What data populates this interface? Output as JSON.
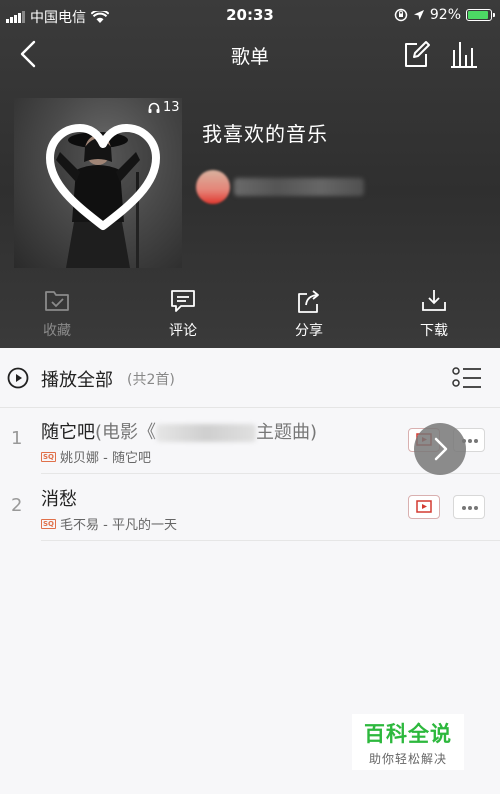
{
  "status_bar": {
    "carrier": "中国电信",
    "time": "20:33",
    "battery": "92%",
    "battery_level": 0.92,
    "icons": [
      "signal-icon",
      "wifi-icon",
      "orientation-lock-icon",
      "location-icon",
      "battery-icon"
    ]
  },
  "nav": {
    "title": "歌单",
    "icons": [
      "back-icon",
      "edit-icon",
      "chart-icon"
    ]
  },
  "playlist": {
    "play_count": "13",
    "title": "我喜欢的音乐"
  },
  "actions": [
    {
      "label": "收藏",
      "icon": "folder-check-icon",
      "enabled": false
    },
    {
      "label": "评论",
      "icon": "comment-icon",
      "enabled": true
    },
    {
      "label": "分享",
      "icon": "share-icon",
      "enabled": true
    },
    {
      "label": "下载",
      "icon": "download-icon",
      "enabled": true
    }
  ],
  "play_all": {
    "label": "播放全部",
    "count": "(共2首)"
  },
  "songs": [
    {
      "index": "1",
      "title": "随它吧",
      "title_prefix": "(电影《",
      "title_suffix": "主题曲)",
      "artist_album": "姚贝娜 - 随它吧",
      "quality_badge": "SQ"
    },
    {
      "index": "2",
      "title": "消愁",
      "artist_album": "毛不易 - 平凡的一天",
      "quality_badge": "SQ"
    }
  ],
  "watermark": {
    "title": "百科全说",
    "subtitle": "助你轻松解决"
  },
  "colors": {
    "header_bg": "#333333",
    "accent_red": "#d33a31",
    "battery_green": "#4cd964",
    "watermark_green": "#2db83d"
  }
}
